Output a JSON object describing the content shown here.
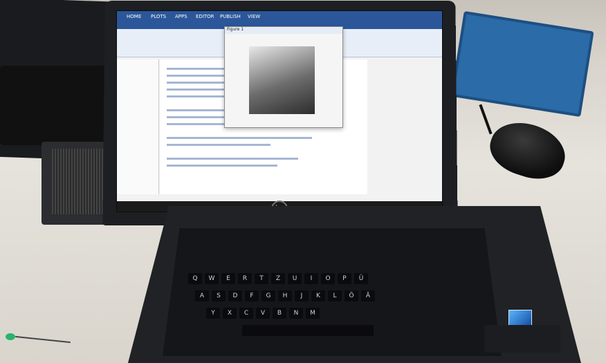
{
  "scene": {
    "description_label": "Laptop running MATLAB on a desk",
    "brand_logo": "hp",
    "screen": {
      "ribbon_tabs": [
        "HOME",
        "PLOTS",
        "APPS",
        "EDITOR",
        "PUBLISH",
        "VIEW"
      ],
      "figure_window_title": "Figure 1",
      "status": {
        "taskbar_time": "",
        "taskbar_date": ""
      }
    },
    "keyboard_rows": [
      [
        "Q",
        "W",
        "E",
        "R",
        "T",
        "Z",
        "U",
        "I",
        "O",
        "P",
        "Ü"
      ],
      [
        "A",
        "S",
        "D",
        "F",
        "G",
        "H",
        "J",
        "K",
        "L",
        "Ö",
        "Ä"
      ],
      [
        "Y",
        "X",
        "C",
        "V",
        "B",
        "N",
        "M"
      ]
    ]
  }
}
